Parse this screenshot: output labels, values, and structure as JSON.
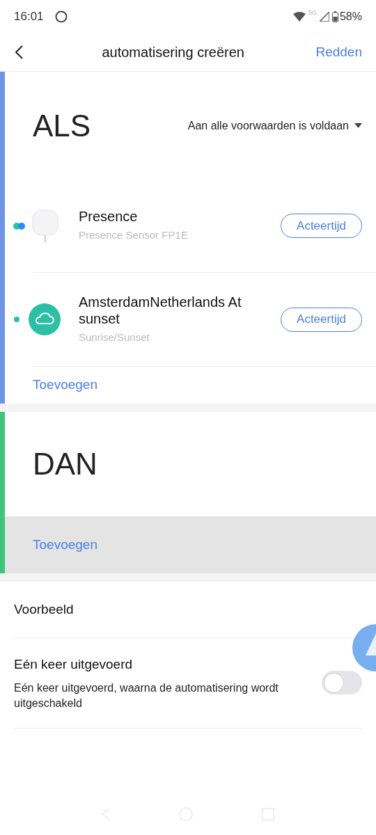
{
  "status_bar": {
    "time": "16:01",
    "network": "5G",
    "battery": "58%"
  },
  "header": {
    "title": "automatisering creëren",
    "action": "Redden"
  },
  "if_section": {
    "heading": "ALS",
    "condition_mode": "Aan alle voorwaarden is voldaan",
    "conditions": [
      {
        "kind": "device",
        "name": "Presence",
        "subtitle": "Presence Sensor FP1E",
        "button": "Acteertijd"
      },
      {
        "kind": "cloud",
        "name": "AmsterdamNetherlands At sunset",
        "subtitle": "Sunrise/Sunset",
        "button": "Acteertijd"
      }
    ],
    "add": "Toevoegen"
  },
  "then_section": {
    "heading": "DAN",
    "add": "Toevoegen",
    "add_pressed": true
  },
  "settings": [
    {
      "kind": "link",
      "label": "Voorbeeld"
    },
    {
      "kind": "toggle",
      "label": "Eén keer uitgevoerd",
      "description": "Eén keer uitgevoerd, waarna de automatisering wordt uitgeschakeld",
      "on": false
    }
  ]
}
